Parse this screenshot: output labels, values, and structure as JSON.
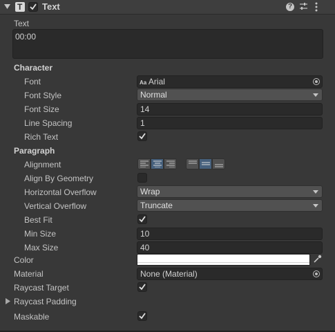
{
  "component": {
    "title": "Text",
    "icon": "text-component-icon",
    "enabled": true,
    "header_icons": [
      "help-icon",
      "presets-icon",
      "kebab-menu-icon"
    ]
  },
  "text_section": {
    "label": "Text",
    "value": "00:00"
  },
  "character": {
    "heading": "Character",
    "font_label": "Font",
    "font_value": "Arial",
    "font_icon_text": "Aa",
    "font_style_label": "Font Style",
    "font_style_value": "Normal",
    "font_size_label": "Font Size",
    "font_size_value": "14",
    "line_spacing_label": "Line Spacing",
    "line_spacing_value": "1",
    "rich_text_label": "Rich Text",
    "rich_text": true
  },
  "paragraph": {
    "heading": "Paragraph",
    "alignment_label": "Alignment",
    "horizontal_alignment_selected": "center",
    "vertical_alignment_selected": "middle",
    "align_by_geometry_label": "Align By Geometry",
    "align_by_geometry": false,
    "horizontal_overflow_label": "Horizontal Overflow",
    "horizontal_overflow_value": "Wrap",
    "vertical_overflow_label": "Vertical Overflow",
    "vertical_overflow_value": "Truncate",
    "best_fit_label": "Best Fit",
    "best_fit": true,
    "min_size_label": "Min Size",
    "min_size_value": "10",
    "max_size_label": "Max Size",
    "max_size_value": "40"
  },
  "color": {
    "label": "Color",
    "value": "#FFFFFF"
  },
  "material": {
    "label": "Material",
    "value": "None (Material)"
  },
  "raycast_target": {
    "label": "Raycast Target",
    "checked": true
  },
  "raycast_padding": {
    "label": "Raycast Padding",
    "expanded": false
  },
  "maskable": {
    "label": "Maskable",
    "checked": true
  },
  "colors": {
    "accent": "#46607c",
    "background": "#383838",
    "field": "#2a2a2a"
  }
}
